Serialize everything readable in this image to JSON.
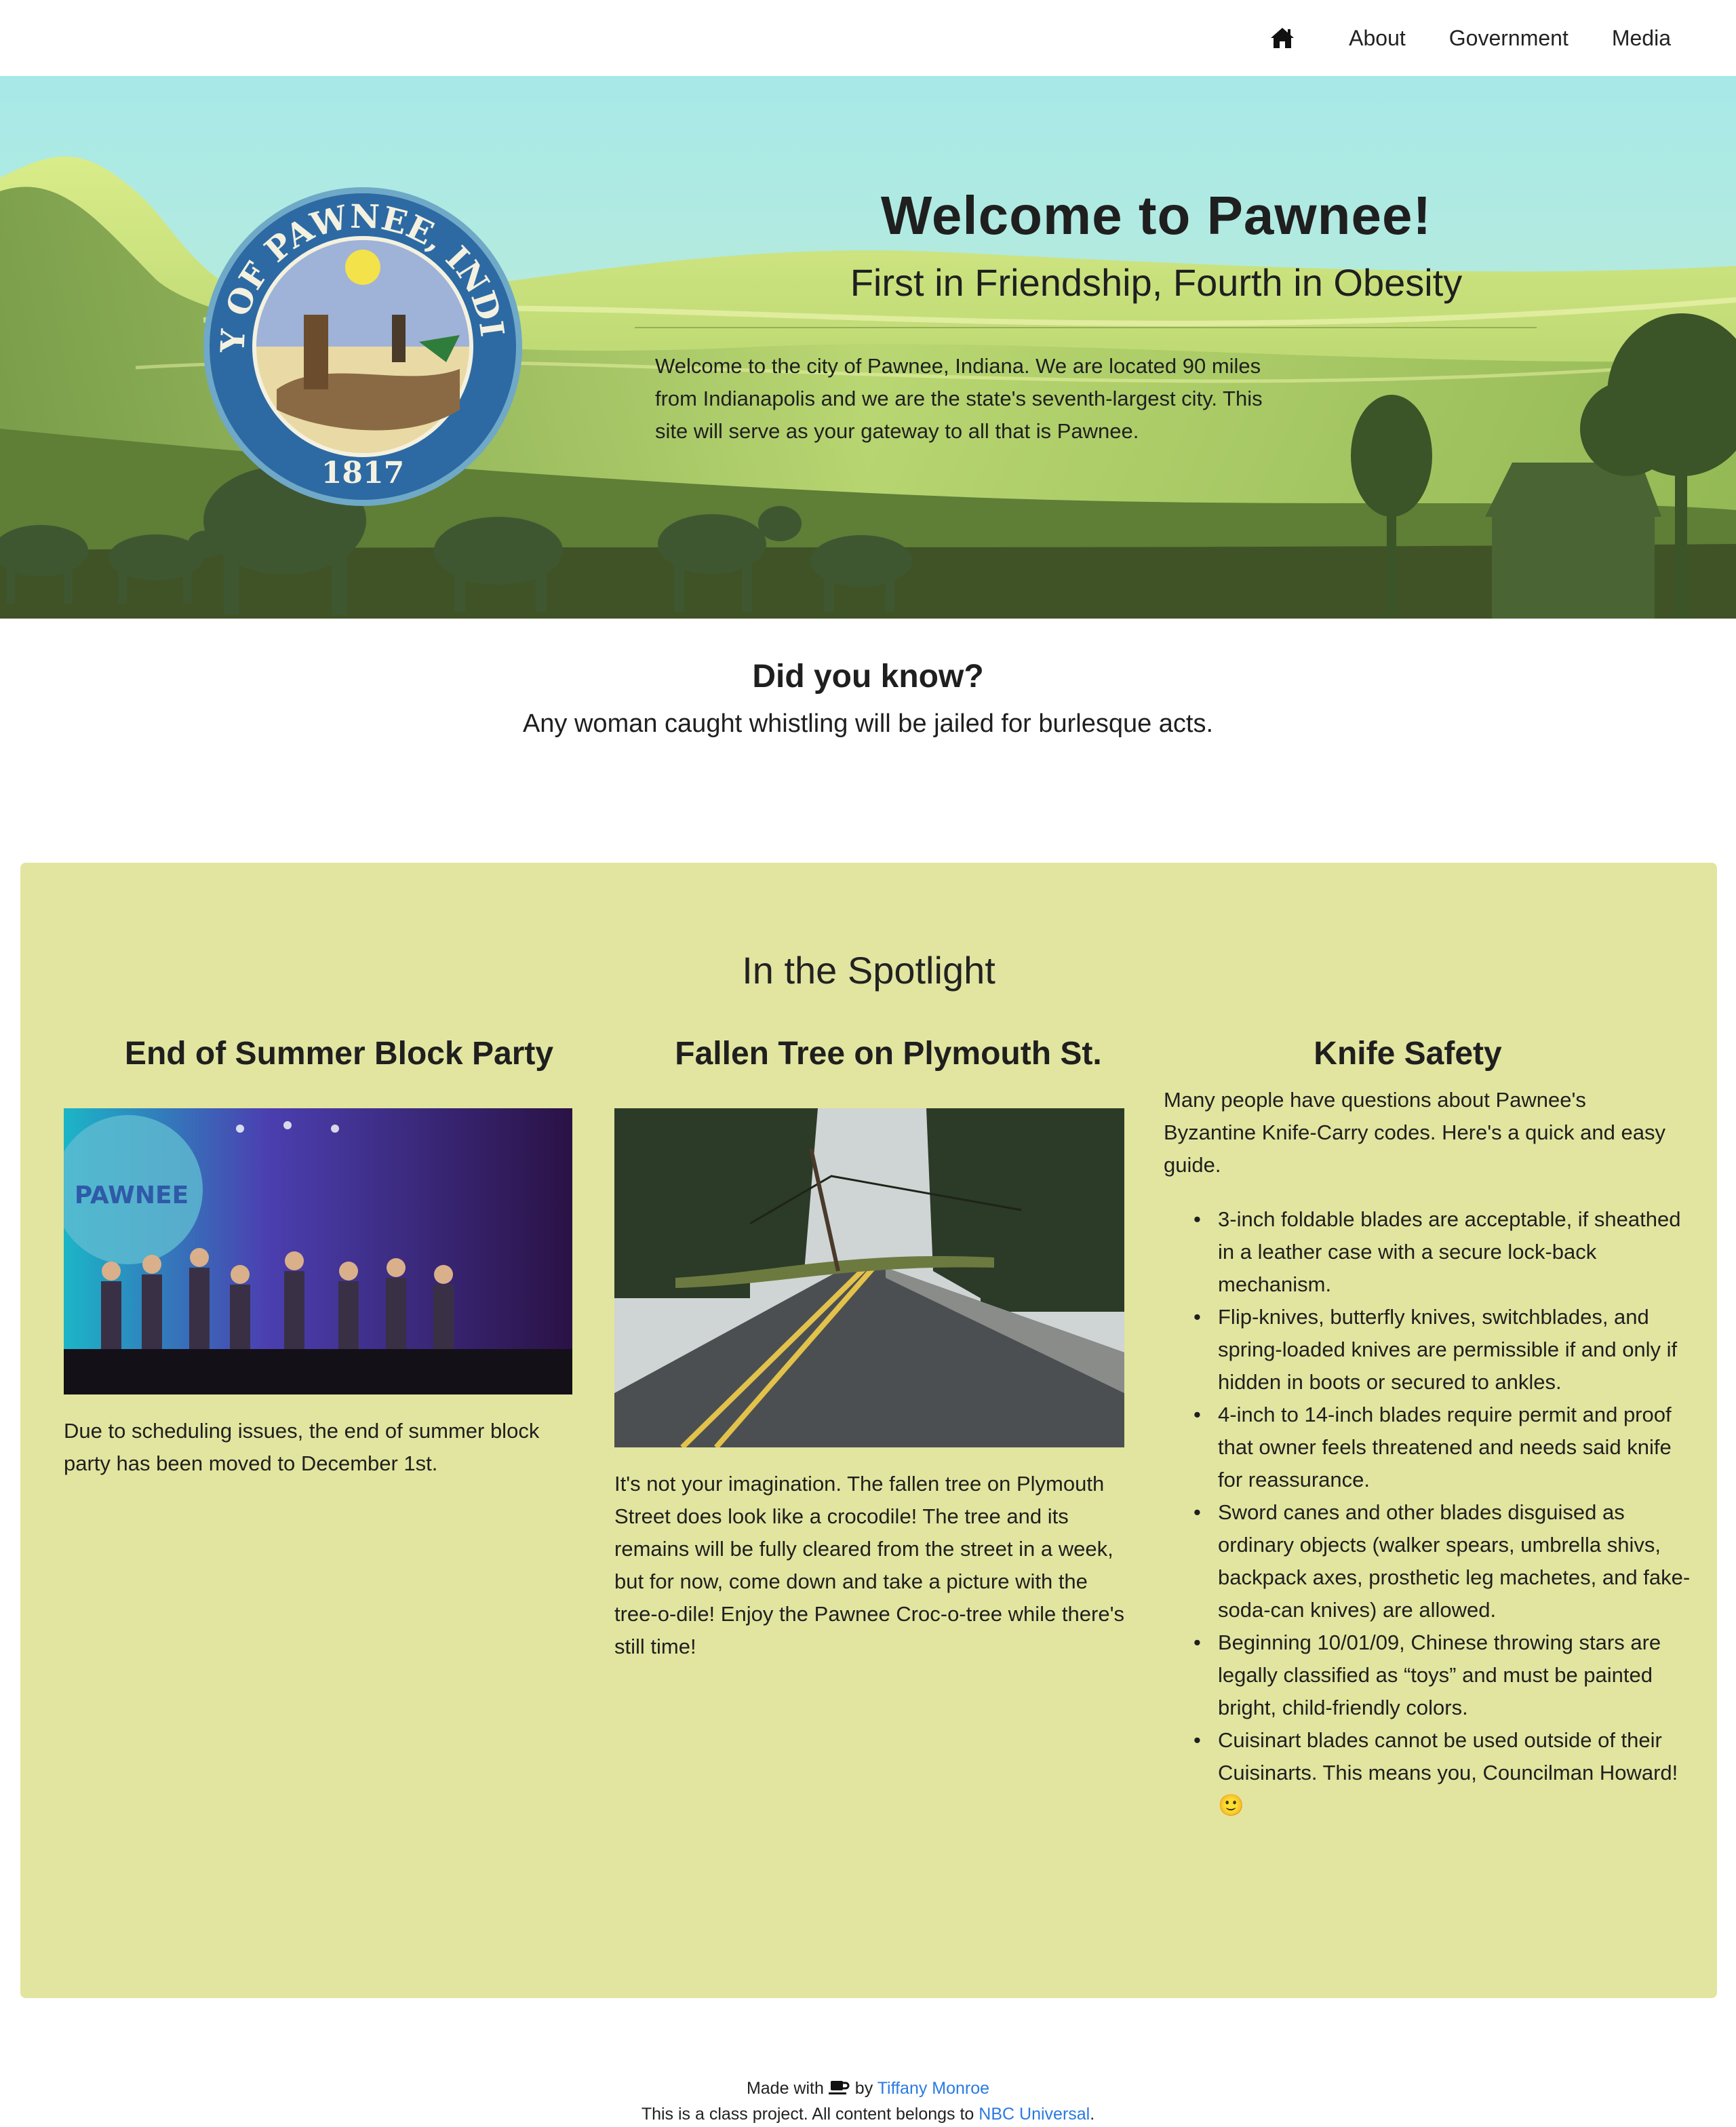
{
  "nav": {
    "items": [
      "About",
      "Government",
      "Media"
    ],
    "home_icon": "home-icon"
  },
  "hero": {
    "title": "Welcome to Pawnee!",
    "subtitle": "First in Friendship, Fourth in Obesity",
    "text": "Welcome to the city of Pawnee, Indiana. We are located 90 miles from Indianapolis and we are the state's seventh-largest city. This site will serve as your gateway to all that is Pawnee.",
    "seal_text": "CITY OF PAWNEE, INDIANA",
    "seal_year": "1817"
  },
  "did_you_know": {
    "title": "Did you know?",
    "text": "Any woman caught whistling will be jailed for burlesque acts."
  },
  "spotlight": {
    "title": "In the Spotlight",
    "columns": [
      {
        "title": "End of Summer Block Party",
        "text": "Due to scheduling issues, the end of summer block party has been moved to December 1st.",
        "image_sign": "PAWNEE"
      },
      {
        "title": "Fallen Tree on Plymouth St.",
        "text": "It's not your imagination. The fallen tree on Plymouth Street does look like a crocodile! The tree and its remains will be fully cleared from the street in a week, but for now, come down and take a picture with the tree-o-dile! Enjoy the Pawnee Croc-o-tree while there's still time!"
      },
      {
        "title": "Knife Safety",
        "intro": "Many people have questions about Pawnee's Byzantine Knife-Carry codes. Here's a quick and easy guide.",
        "rules": [
          "3-inch foldable blades are acceptable, if sheathed in a leather case with a secure lock-back mechanism.",
          "Flip-knives, butterfly knives, switchblades, and spring-loaded knives are permissible if and only if hidden in boots or secured to ankles.",
          "4-inch to 14-inch blades require permit and proof that owner feels threatened and needs said knife for reassurance.",
          "Sword canes and other blades disguised as ordinary objects (walker spears, umbrella shivs, backpack axes, prosthetic leg machetes, and fake-soda-can knives) are allowed.",
          "Beginning 10/01/09, Chinese throwing stars are legally classified as “toys” and must be painted bright, child-friendly colors.",
          "Cuisinart blades cannot be used outside of their Cuisinarts. This means you, Councilman Howard! 🙂"
        ]
      }
    ]
  },
  "footer": {
    "made_with": "Made with",
    "by": "by",
    "author": "Tiffany Monroe",
    "line2_prefix": "This is a class project. All content belongs to",
    "owner": "NBC Universal",
    "line2_suffix": "."
  },
  "colors": {
    "spotlight_bg": "#e2e59f",
    "link": "#2a7ae2",
    "sky": "#a9e8e6"
  }
}
